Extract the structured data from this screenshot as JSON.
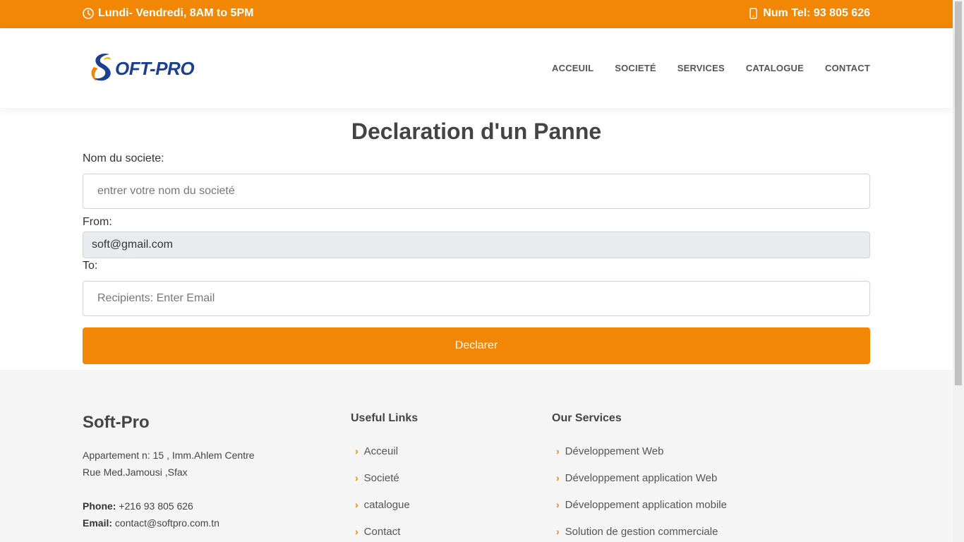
{
  "topbar": {
    "hours": "Lundi- Vendredi, 8AM to 5PM",
    "phone": "Num Tel: 93 805 626"
  },
  "header": {
    "logo_text": "OFT-PRO",
    "nav": [
      {
        "label": "ACCEUIL"
      },
      {
        "label": "SOCIETÉ"
      },
      {
        "label": "SERVICES"
      },
      {
        "label": "CATALOGUE"
      },
      {
        "label": "CONTACT"
      }
    ]
  },
  "form": {
    "title": "Declaration d'un Panne",
    "company_label": "Nom du societe:",
    "company_placeholder": "entrer votre nom du societé",
    "from_label": "From:",
    "from_value": "soft@gmail.com",
    "to_label": "To:",
    "to_placeholder": "Recipients: Enter Email",
    "submit_label": "Declarer"
  },
  "footer": {
    "brand": "Soft-Pro",
    "address_line1": "Appartement n: 15 , Imm.Ahlem Centre",
    "address_line2": "Rue Med.Jamousi ,Sfax",
    "phone_label": "Phone:",
    "phone_value": "+216 93 805 626",
    "email_label": "Email:",
    "email_value": "contact@softpro.com.tn",
    "useful_links": {
      "title": "Useful Links",
      "items": [
        "Acceuil",
        "Societé",
        "catalogue",
        "Contact"
      ]
    },
    "services": {
      "title": "Our Services",
      "items": [
        "Développement Web",
        "Développement application Web",
        "Développement application mobile",
        "Solution de gestion commerciale"
      ]
    }
  },
  "colors": {
    "accent": "#f28705",
    "logo_blue": "#1c3f8f"
  }
}
